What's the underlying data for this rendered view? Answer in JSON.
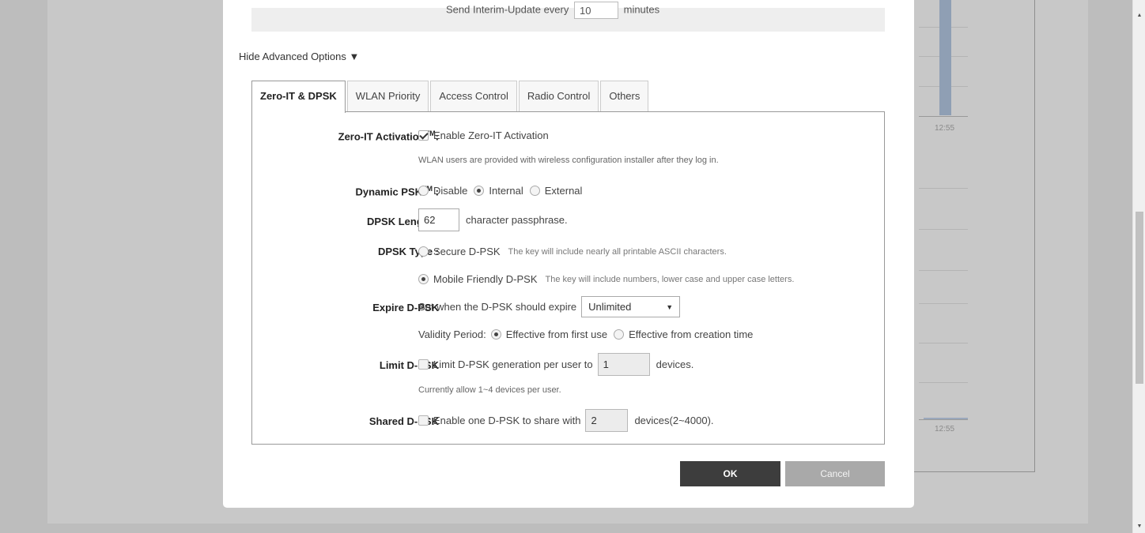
{
  "interim": {
    "prefix": "Send Interim-Update every",
    "value": "10",
    "suffix": "minutes"
  },
  "advanced_toggle": "Hide Advanced Options ▼",
  "tabs": [
    {
      "label": "Zero-IT & DPSK",
      "active": true
    },
    {
      "label": "WLAN Priority",
      "active": false
    },
    {
      "label": "Access Control",
      "active": false
    },
    {
      "label": "Radio Control",
      "active": false
    },
    {
      "label": "Others",
      "active": false
    }
  ],
  "zero_it": {
    "label": "Zero-IT Activation",
    "tm": "TM",
    "colon": ":",
    "checkbox_label": "Enable Zero-IT Activation",
    "checked": true,
    "note": "WLAN users are provided with wireless configuration installer after they log in."
  },
  "dynamic_psk": {
    "label": "Dynamic PSK",
    "tm": "TM",
    "colon": " :",
    "options": [
      "Disable",
      "Internal",
      "External"
    ],
    "selected": "Internal"
  },
  "dpsk_length": {
    "label": "DPSK Length :",
    "value": "62",
    "suffix": "character passphrase."
  },
  "dpsk_type": {
    "label": "DPSK Type :",
    "secure_label": "Secure D-PSK",
    "secure_note": "The key will include nearly all printable ASCII characters.",
    "mobile_label": "Mobile Friendly D-PSK",
    "mobile_note": "The key will include numbers, lower case and upper case letters.",
    "selected": "Mobile Friendly D-PSK"
  },
  "expire": {
    "label": "Expire D-PSK",
    "prefix": "Set when the D-PSK should expire",
    "selected": "Unlimited",
    "validity_label": "Validity Period:",
    "option_first_use": "Effective from first use",
    "option_creation": "Effective from creation time",
    "validity_selected": "Effective from first use"
  },
  "limit": {
    "label": "Limit D-PSK",
    "checkbox_label": "Limit D-PSK generation per user to",
    "value": "1",
    "suffix": "devices.",
    "note": "Currently allow 1~4 devices per user."
  },
  "shared": {
    "label": "Shared D-PSK",
    "checkbox_label": "Enable one D-PSK to share with",
    "value": "2",
    "suffix": "devices(2~4000)."
  },
  "buttons": {
    "ok": "OK",
    "cancel": "Cancel"
  },
  "background_chart": {
    "tick_top": "12:55",
    "tick_bottom": "12:55"
  }
}
